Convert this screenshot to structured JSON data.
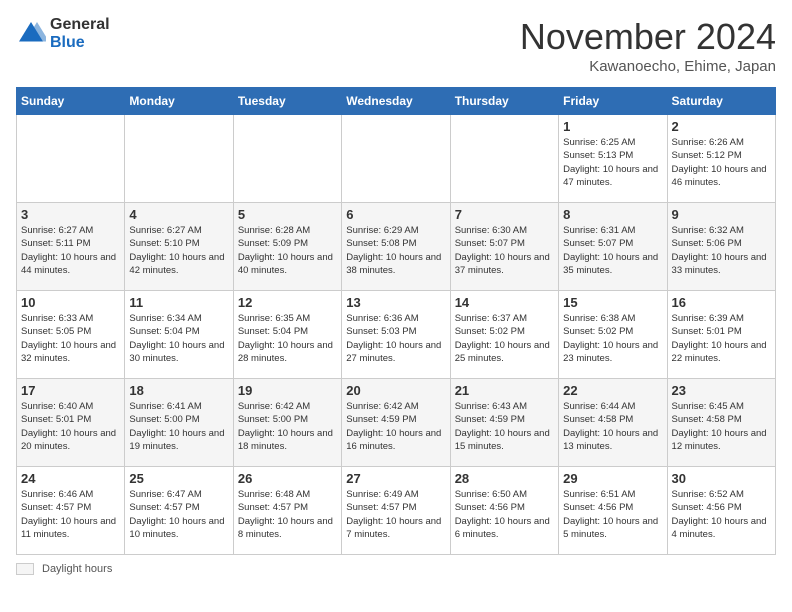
{
  "header": {
    "logo_general": "General",
    "logo_blue": "Blue",
    "title": "November 2024",
    "location": "Kawanoecho, Ehime, Japan"
  },
  "days_of_week": [
    "Sunday",
    "Monday",
    "Tuesday",
    "Wednesday",
    "Thursday",
    "Friday",
    "Saturday"
  ],
  "weeks": [
    [
      {
        "day": "",
        "info": ""
      },
      {
        "day": "",
        "info": ""
      },
      {
        "day": "",
        "info": ""
      },
      {
        "day": "",
        "info": ""
      },
      {
        "day": "",
        "info": ""
      },
      {
        "day": "1",
        "info": "Sunrise: 6:25 AM\nSunset: 5:13 PM\nDaylight: 10 hours and 47 minutes."
      },
      {
        "day": "2",
        "info": "Sunrise: 6:26 AM\nSunset: 5:12 PM\nDaylight: 10 hours and 46 minutes."
      }
    ],
    [
      {
        "day": "3",
        "info": "Sunrise: 6:27 AM\nSunset: 5:11 PM\nDaylight: 10 hours and 44 minutes."
      },
      {
        "day": "4",
        "info": "Sunrise: 6:27 AM\nSunset: 5:10 PM\nDaylight: 10 hours and 42 minutes."
      },
      {
        "day": "5",
        "info": "Sunrise: 6:28 AM\nSunset: 5:09 PM\nDaylight: 10 hours and 40 minutes."
      },
      {
        "day": "6",
        "info": "Sunrise: 6:29 AM\nSunset: 5:08 PM\nDaylight: 10 hours and 38 minutes."
      },
      {
        "day": "7",
        "info": "Sunrise: 6:30 AM\nSunset: 5:07 PM\nDaylight: 10 hours and 37 minutes."
      },
      {
        "day": "8",
        "info": "Sunrise: 6:31 AM\nSunset: 5:07 PM\nDaylight: 10 hours and 35 minutes."
      },
      {
        "day": "9",
        "info": "Sunrise: 6:32 AM\nSunset: 5:06 PM\nDaylight: 10 hours and 33 minutes."
      }
    ],
    [
      {
        "day": "10",
        "info": "Sunrise: 6:33 AM\nSunset: 5:05 PM\nDaylight: 10 hours and 32 minutes."
      },
      {
        "day": "11",
        "info": "Sunrise: 6:34 AM\nSunset: 5:04 PM\nDaylight: 10 hours and 30 minutes."
      },
      {
        "day": "12",
        "info": "Sunrise: 6:35 AM\nSunset: 5:04 PM\nDaylight: 10 hours and 28 minutes."
      },
      {
        "day": "13",
        "info": "Sunrise: 6:36 AM\nSunset: 5:03 PM\nDaylight: 10 hours and 27 minutes."
      },
      {
        "day": "14",
        "info": "Sunrise: 6:37 AM\nSunset: 5:02 PM\nDaylight: 10 hours and 25 minutes."
      },
      {
        "day": "15",
        "info": "Sunrise: 6:38 AM\nSunset: 5:02 PM\nDaylight: 10 hours and 23 minutes."
      },
      {
        "day": "16",
        "info": "Sunrise: 6:39 AM\nSunset: 5:01 PM\nDaylight: 10 hours and 22 minutes."
      }
    ],
    [
      {
        "day": "17",
        "info": "Sunrise: 6:40 AM\nSunset: 5:01 PM\nDaylight: 10 hours and 20 minutes."
      },
      {
        "day": "18",
        "info": "Sunrise: 6:41 AM\nSunset: 5:00 PM\nDaylight: 10 hours and 19 minutes."
      },
      {
        "day": "19",
        "info": "Sunrise: 6:42 AM\nSunset: 5:00 PM\nDaylight: 10 hours and 18 minutes."
      },
      {
        "day": "20",
        "info": "Sunrise: 6:42 AM\nSunset: 4:59 PM\nDaylight: 10 hours and 16 minutes."
      },
      {
        "day": "21",
        "info": "Sunrise: 6:43 AM\nSunset: 4:59 PM\nDaylight: 10 hours and 15 minutes."
      },
      {
        "day": "22",
        "info": "Sunrise: 6:44 AM\nSunset: 4:58 PM\nDaylight: 10 hours and 13 minutes."
      },
      {
        "day": "23",
        "info": "Sunrise: 6:45 AM\nSunset: 4:58 PM\nDaylight: 10 hours and 12 minutes."
      }
    ],
    [
      {
        "day": "24",
        "info": "Sunrise: 6:46 AM\nSunset: 4:57 PM\nDaylight: 10 hours and 11 minutes."
      },
      {
        "day": "25",
        "info": "Sunrise: 6:47 AM\nSunset: 4:57 PM\nDaylight: 10 hours and 10 minutes."
      },
      {
        "day": "26",
        "info": "Sunrise: 6:48 AM\nSunset: 4:57 PM\nDaylight: 10 hours and 8 minutes."
      },
      {
        "day": "27",
        "info": "Sunrise: 6:49 AM\nSunset: 4:57 PM\nDaylight: 10 hours and 7 minutes."
      },
      {
        "day": "28",
        "info": "Sunrise: 6:50 AM\nSunset: 4:56 PM\nDaylight: 10 hours and 6 minutes."
      },
      {
        "day": "29",
        "info": "Sunrise: 6:51 AM\nSunset: 4:56 PM\nDaylight: 10 hours and 5 minutes."
      },
      {
        "day": "30",
        "info": "Sunrise: 6:52 AM\nSunset: 4:56 PM\nDaylight: 10 hours and 4 minutes."
      }
    ]
  ],
  "legend": {
    "daylight_label": "Daylight hours"
  }
}
